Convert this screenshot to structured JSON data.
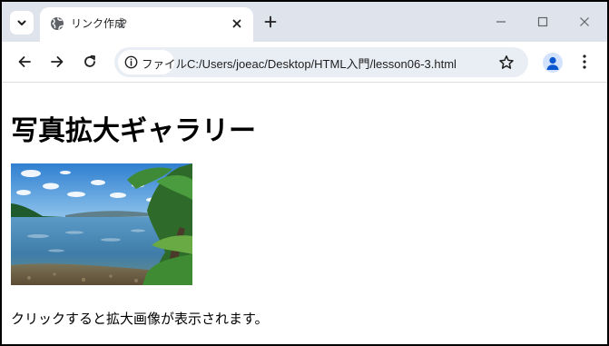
{
  "browser": {
    "tab": {
      "title": "リンク作成",
      "favicon": "globe-icon",
      "status_icon": "link-icon"
    },
    "new_tab_icon": "plus-icon",
    "window_controls": [
      "minimize-icon",
      "maximize-icon",
      "close-icon"
    ],
    "nav": [
      "back-icon",
      "forward-icon",
      "reload-icon"
    ],
    "omnibox": {
      "site_label": "ファイル",
      "url": "C:/Users/joeac/Desktop/HTML入門/lesson06-3.html"
    },
    "accent_color": "#0b57d0",
    "tabstrip_color": "#dfe3eb"
  },
  "page": {
    "title": "写真拡大ギャラリー",
    "image_description_icon": "lake-photo",
    "caption": "クリックすると拡大画像が表示されます。"
  }
}
